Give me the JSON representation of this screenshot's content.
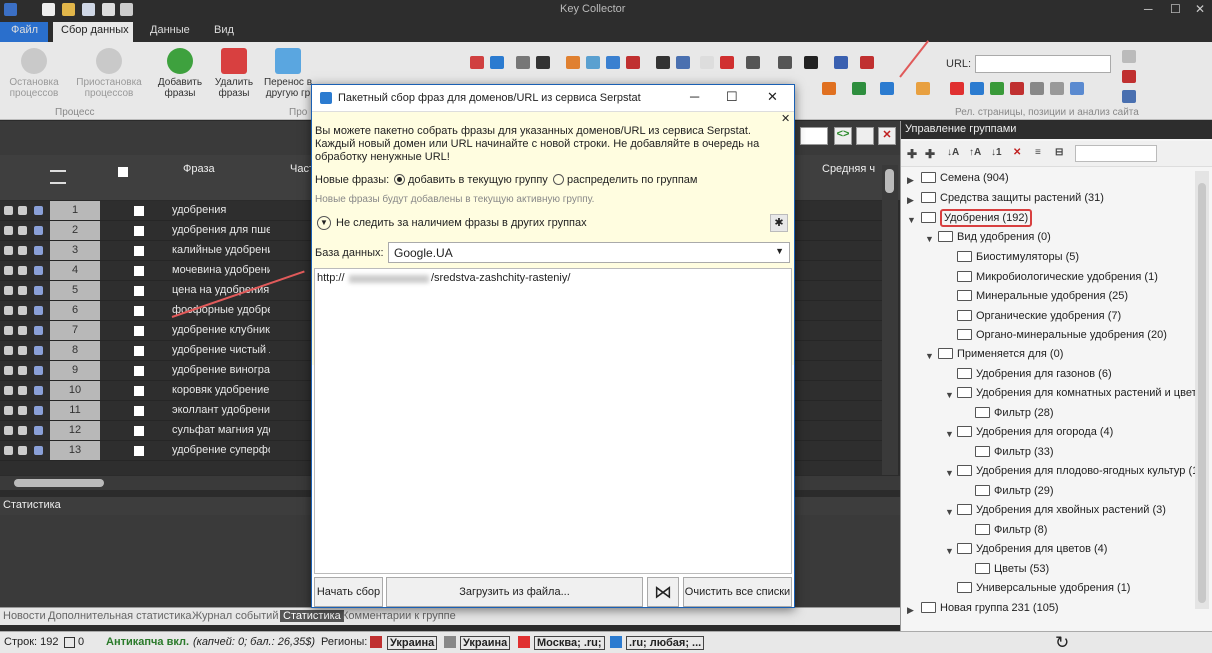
{
  "app": {
    "title": "Key Collector"
  },
  "ribbon": {
    "tabs": [
      "Файл",
      "Сбор данных",
      "Данные",
      "Вид"
    ],
    "buttons": [
      {
        "label": "Остановка процессов"
      },
      {
        "label": "Приостановка процессов"
      },
      {
        "label": "Добавить фразы"
      },
      {
        "label": "Удалить фразы"
      },
      {
        "label": "Перенос в другую гр"
      }
    ],
    "groups": {
      "process": "Процесс",
      "other": "Про",
      "rel": "Рел. страницы, позиции и анализ сайта"
    },
    "url_label": "URL:"
  },
  "grid": {
    "columns": {
      "phrase": "Фраза",
      "freq": "Част",
      "avg": "Средняя ч"
    },
    "rows": [
      {
        "n": "1",
        "phrase": "удобрения"
      },
      {
        "n": "2",
        "phrase": "удобрения для пше"
      },
      {
        "n": "3",
        "phrase": "калийные удобрени"
      },
      {
        "n": "4",
        "phrase": "мочевина удобрени"
      },
      {
        "n": "5",
        "phrase": "цена на удобрения"
      },
      {
        "n": "6",
        "phrase": "фосфорные удобре"
      },
      {
        "n": "7",
        "phrase": "удобрение клубник"
      },
      {
        "n": "8",
        "phrase": "удобрение чистый л"
      },
      {
        "n": "9",
        "phrase": "удобрение виногра"
      },
      {
        "n": "10",
        "phrase": "коровяк удобрение"
      },
      {
        "n": "11",
        "phrase": "эколлант удобрени"
      },
      {
        "n": "12",
        "phrase": "сульфат магния удо"
      },
      {
        "n": "13",
        "phrase": "удобрение суперфо"
      }
    ]
  },
  "stats": {
    "title": "Статистика"
  },
  "bottom_tabs": [
    "Новости",
    "Дополнительная статистика",
    "Журнал событий",
    "Статистика",
    "Комментарии к группе"
  ],
  "statusbar": {
    "rows": "Строк: 192",
    "checked": "0",
    "anticaptcha": "Антикапча вкл.",
    "anticaptcha_info": "(капчей: 0; бал.: 26,35$)",
    "regions_label": "Регионы:",
    "region1": "Украина",
    "region2": "Украина",
    "region3": "Москва; .ru;",
    "region4": ".ru; любая; ..."
  },
  "groups_panel": {
    "title": "Управление группами",
    "nodes": [
      {
        "label": "Семена (904)"
      },
      {
        "label": "Средства защиты растений (31)"
      },
      {
        "label": "Удобрения (192)"
      },
      {
        "label": "Вид удобрения (0)"
      },
      {
        "label": "Биостимуляторы (5)"
      },
      {
        "label": "Микробиологические удобрения (1)"
      },
      {
        "label": "Минеральные удобрения (25)"
      },
      {
        "label": "Органические удобрения (7)"
      },
      {
        "label": "Органо-минеральные удобрения (20)"
      },
      {
        "label": "Применяется для (0)"
      },
      {
        "label": "Удобрения для газонов (6)"
      },
      {
        "label": "Удобрения для комнатных растений и цвето"
      },
      {
        "label": "Фильтр (28)"
      },
      {
        "label": "Удобрения для огорода (4)"
      },
      {
        "label": "Фильтр (33)"
      },
      {
        "label": "Удобрения для плодово-ягодных культур (1"
      },
      {
        "label": "Фильтр (29)"
      },
      {
        "label": "Удобрения для хвойных растений (3)"
      },
      {
        "label": "Фильтр (8)"
      },
      {
        "label": "Удобрения для цветов (4)"
      },
      {
        "label": "Цветы (53)"
      },
      {
        "label": "Универсальные удобрения (1)"
      },
      {
        "label": "Новая группа 231 (105)"
      }
    ]
  },
  "dialog": {
    "title": "Пакетный сбор фраз для доменов/URL из сервиса Serpstat",
    "info": "Вы можете пакетно собрать фразы для указанных доменов/URL из сервиса Serpstat. Каждый новый домен или URL начинайте с новой строки. Не добавляйте в очередь на обработку ненужные URL!",
    "new_phrases_label": "Новые фразы:",
    "opt_add": "добавить в текущую группу",
    "opt_distribute": "распределить по группам",
    "hint": "Новые фразы будут добавлены в текущую активную группу.",
    "no_track": "Не следить за наличием фразы в других группах",
    "db_label": "База данных:",
    "db_value": "Google.UA",
    "url_prefix": "http://",
    "url_suffix": "/sredstva-zashchity-rasteniy/",
    "btn_start": "Начать сбор",
    "btn_load": "Загрузить из файла...",
    "btn_clear": "Очистить все списки"
  }
}
